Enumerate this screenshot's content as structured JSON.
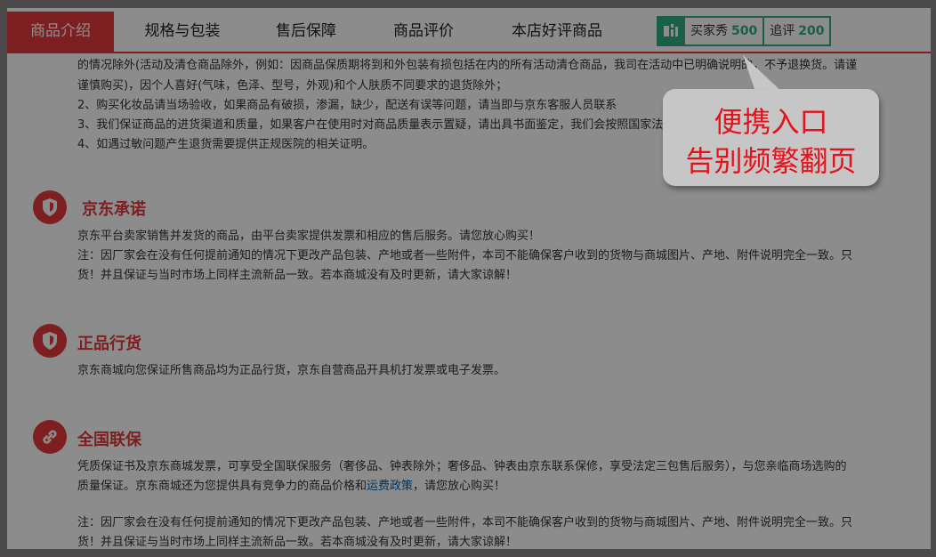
{
  "tabs": [
    {
      "label": "商品介绍",
      "active": true
    },
    {
      "label": "规格与包装",
      "active": false
    },
    {
      "label": "售后保障",
      "active": false
    },
    {
      "label": "商品评价",
      "active": false
    },
    {
      "label": "本店好评商品",
      "active": false
    }
  ],
  "reviews": {
    "buyer_show_label": "买家秀",
    "buyer_show_count": "500",
    "follow_up_label": "追评",
    "follow_up_count": "200"
  },
  "intro_lines": [
    "的情况除外(活动及清仓商品除外，例如：因商品保质期将到和外包装有损包括在内的所有活动清仓商品，我司在活动中已明确说明的，不予退换货。请谨",
    "谨慎购买)，因个人喜好(气味，色泽、型号，外观)和个人肤质不同要求的退货除外；",
    "2、购买化妆品请当场验收，如果商品有破损，渗漏，缺少，配送有误等问题，请当即与京东客服人员联系",
    "3、我们保证商品的进货渠道和质量，如果客户在使用时对商品质量表示置疑，请出具书面鉴定，我们会按照国家法律规定予以处理。",
    "4、如遇过敏问题产生退货需要提供正规医院的相关证明。"
  ],
  "sections": {
    "promise": {
      "title": "京东承诺",
      "lines": [
        "京东平台卖家销售并发货的商品，由平台卖家提供发票和相应的售后服务。请您放心购买！",
        "注：因厂家会在没有任何提前通知的情况下更改产品包装、产地或者一些附件，本司不能确保客户收到的货物与商城图片、产地、附件说明完全一致。只",
        "货！并且保证与当时市场上同样主流新品一致。若本商城没有及时更新，请大家谅解！"
      ]
    },
    "genuine": {
      "title": "正品行货",
      "lines": [
        "京东商城向您保证所售商品均为正品行货，京东自营商品开具机打发票或电子发票。"
      ]
    },
    "warranty": {
      "title": "全国联保",
      "line1": "凭质保证书及京东商城发票，可享受全国联保服务（奢侈品、钟表除外；奢侈品、钟表由京东联系保修，享受法定三包售后服务），与您亲临商场选购的",
      "line2_pre": "质量保证。京东商城还为您提供具有竞争力的商品价格和",
      "line2_link": "运费政策",
      "line2_post": "，请您放心购买！",
      "note1": "注：因厂家会在没有任何提前通知的情况下更改产品包装、产地或者一些附件，本司不能确保客户收到的货物与商城图片、产地、附件说明完全一致。只",
      "note2": "货！并且保证与当时市场上同样主流新品一致。若本商城没有及时更新，请大家谅解！"
    }
  },
  "callout": {
    "line1": "便携入口",
    "line2": "告别频繁翻页"
  },
  "colors": {
    "accent_red": "#e4393c",
    "review_green": "#2fad85",
    "callout_text": "#e4121b"
  }
}
